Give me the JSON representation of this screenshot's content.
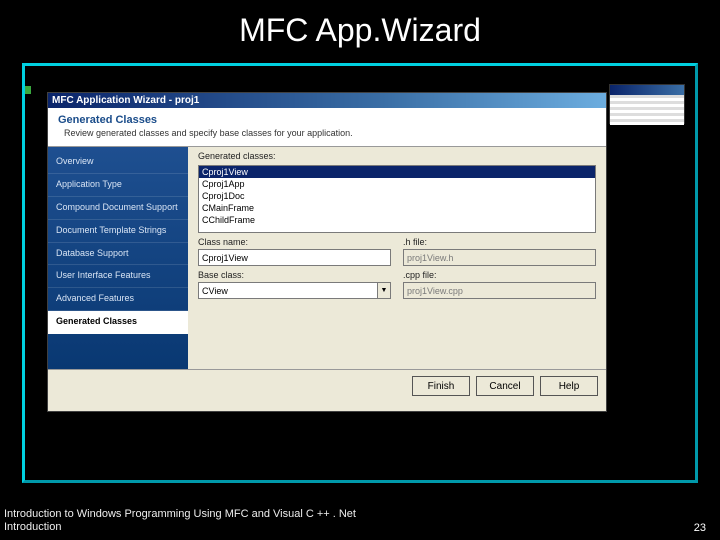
{
  "slide": {
    "title": "MFC App.Wizard",
    "footer_line1": "Introduction to Windows Programming Using MFC and Visual C ++ . Net",
    "footer_line2": "Introduction",
    "page_number": "23"
  },
  "wizard": {
    "title": "MFC Application Wizard - proj1",
    "hdr_title": "Generated Classes",
    "hdr_sub": "Review generated classes and specify base classes for your application.",
    "nav": [
      "Overview",
      "Application Type",
      "Compound Document Support",
      "Document Template Strings",
      "Database Support",
      "User Interface Features",
      "Advanced Features",
      "Generated Classes"
    ],
    "nav_selected_index": 7,
    "labels": {
      "gen": "Generated classes:",
      "classname": "Class name:",
      "hfile": ".h file:",
      "baseclass": "Base class:",
      "cppfile": ".cpp file:"
    },
    "gen_list": [
      "Cproj1View",
      "Cproj1App",
      "Cproj1Doc",
      "CMainFrame",
      "CChildFrame"
    ],
    "gen_list_selected_index": 0,
    "fields": {
      "classname": "Cproj1View",
      "hfile": "proj1View.h",
      "baseclass": "CView",
      "cppfile": "proj1View.cpp"
    },
    "buttons": {
      "finish": "Finish",
      "cancel": "Cancel",
      "help": "Help"
    }
  }
}
